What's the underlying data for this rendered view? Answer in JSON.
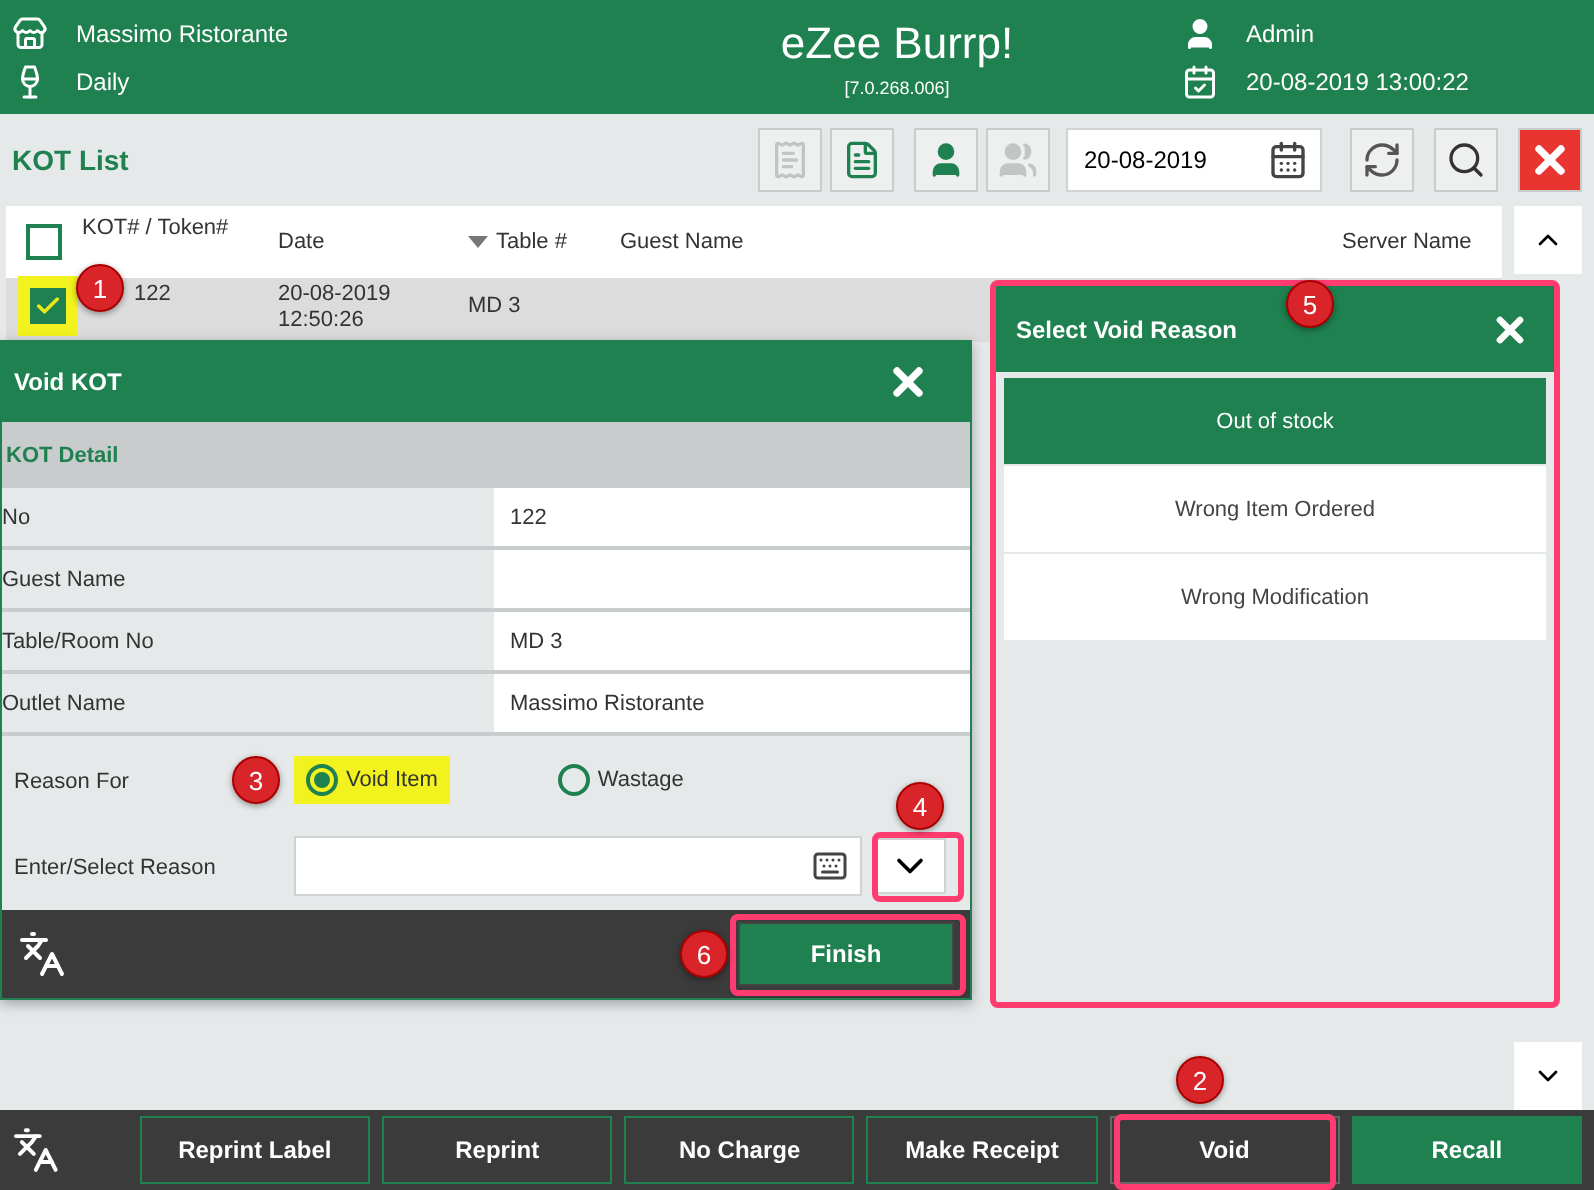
{
  "header": {
    "outlet": "Massimo Ristorante",
    "period": "Daily",
    "app_title": "eZee Burrp!",
    "version": "[7.0.268.006]",
    "user": "Admin",
    "datetime": "20-08-2019 13:00:22"
  },
  "toolbar": {
    "title": "KOT List",
    "date": "20-08-2019",
    "view_buttons": [
      {
        "kind": "receipt",
        "disabled": true
      },
      {
        "kind": "list",
        "disabled": false
      },
      {
        "kind": "user",
        "disabled": false
      },
      {
        "kind": "users",
        "disabled": true
      }
    ]
  },
  "table": {
    "all_checked": false,
    "columns": [
      "KOT# / Token#",
      "Date",
      "Table #",
      "Guest Name",
      "Server Name"
    ],
    "rows": [
      {
        "checked": true,
        "selected": true,
        "kot": "122",
        "date": "20-08-2019",
        "time": "12:50:26",
        "table": "MD 3"
      }
    ]
  },
  "void_dialog": {
    "title": "Void KOT",
    "section": "KOT Detail",
    "fields": [
      {
        "label": "No",
        "value": "122"
      },
      {
        "label": "Guest Name"
      },
      {
        "label": "Table/Room No",
        "value": "MD 3"
      },
      {
        "label": "Outlet Name",
        "value": "Massimo Ristorante"
      }
    ],
    "reason_for_label": "Reason For",
    "reason_options": [
      {
        "label": "Void Item",
        "selected": true
      },
      {
        "label": "Wastage",
        "selected": false
      }
    ],
    "reason_label": "Enter/Select Reason",
    "finish": "Finish"
  },
  "reason_dialog": {
    "title": "Select Void Reason",
    "items": [
      {
        "label": "Out of stock",
        "selected": true
      },
      {
        "label": "Wrong Item Ordered",
        "selected": false
      },
      {
        "label": "Wrong Modification",
        "selected": false
      }
    ]
  },
  "bottom_buttons": [
    {
      "label": "Reprint Label",
      "kind": "outline"
    },
    {
      "label": "Reprint",
      "kind": "outline"
    },
    {
      "label": "No Charge",
      "kind": "outline"
    },
    {
      "label": "Make Receipt",
      "kind": "outline"
    },
    {
      "label": "Void",
      "kind": "focused"
    },
    {
      "label": "Recall",
      "kind": "filled"
    }
  ],
  "callouts": [
    "1",
    "2",
    "3",
    "4",
    "5",
    "6"
  ]
}
